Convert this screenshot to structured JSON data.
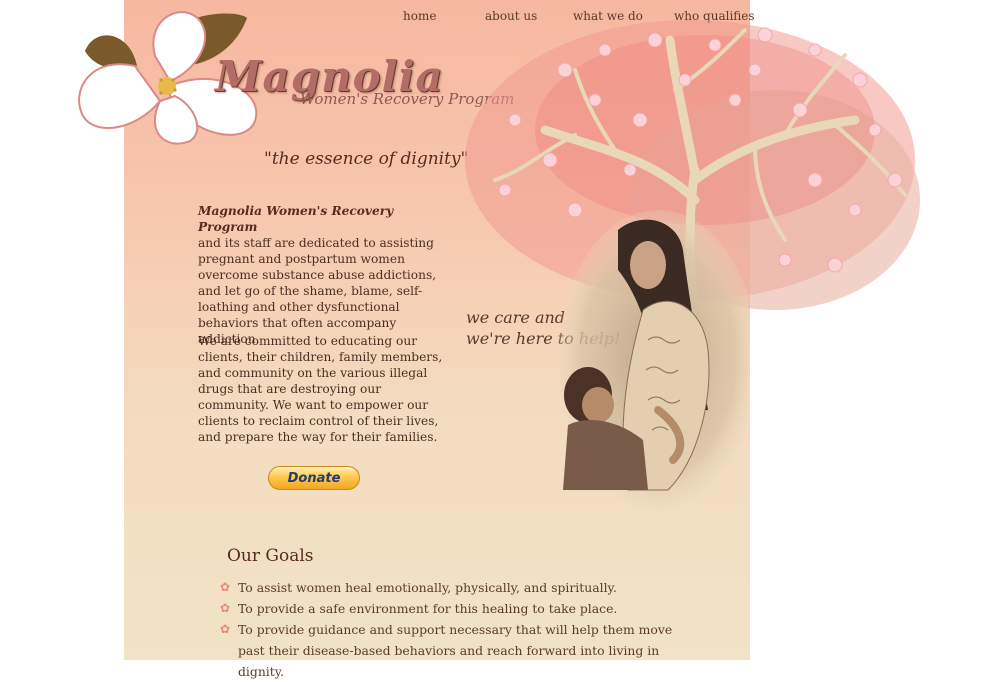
{
  "nav": {
    "items": [
      {
        "label": "home"
      },
      {
        "label": "about us"
      },
      {
        "label": "what we do"
      },
      {
        "label": "who qualifies"
      }
    ]
  },
  "logo": {
    "title": "Magnolia",
    "subtitle": "Women's Recovery Program"
  },
  "tagline": "\"the essence of dignity\"",
  "intro": {
    "lead": "Magnolia Women's Recovery Program",
    "text": "and its staff are dedicated to assisting pregnant and postpartum women overcome substance abuse addictions, and let go of the shame, blame, self-loathing and other dysfunctional behaviors that often accompany addiction."
  },
  "committed": "We are committed to educating our clients, their children, family members, and community on the various illegal drugs that are destroying our community. We want to empower our clients to reclaim control of their lives, and prepare the way for their families.",
  "donate_label": "Donate",
  "care": {
    "line1": "we care and",
    "line2": "we're here to help!"
  },
  "goals": {
    "title": "Our Goals",
    "items": [
      "To assist women heal emotionally, physically, and spiritually.",
      "To provide a safe environment for this healing to take place.",
      "To provide guidance and support necessary that will help them move past their disease-based behaviors and reach forward into living in dignity."
    ]
  },
  "icons": {
    "goal_bullet": "flower-bullet-icon",
    "logo_flower": "magnolia-flower-icon"
  },
  "colors": {
    "accent": "#b46d66",
    "peach_top": "#f7b7a1",
    "cream_bottom": "#f1e3c6",
    "text": "#4a2e22"
  }
}
